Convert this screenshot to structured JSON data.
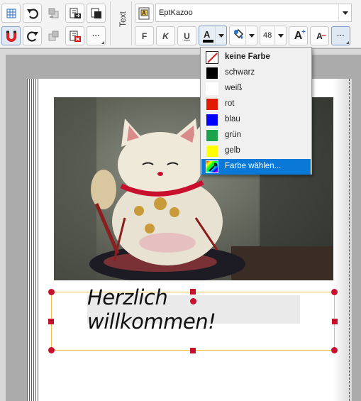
{
  "toolbar": {
    "section_label": "Text",
    "font_name": "EptKazoo",
    "bold_label": "F",
    "italic_label": "K",
    "underline_label": "U",
    "font_size": "48",
    "grow_label": "A",
    "shrink_label": "A",
    "more_label": "···"
  },
  "canvas": {
    "headline": "Herzlich willkommen!"
  },
  "color_menu": {
    "items": [
      {
        "label": "keine Farbe",
        "color": "none",
        "bold": true
      },
      {
        "label": "schwarz",
        "color": "#000000"
      },
      {
        "label": "weiß",
        "color": "#ffffff"
      },
      {
        "label": "rot",
        "color": "#e01b00"
      },
      {
        "label": "blau",
        "color": "#0000ff"
      },
      {
        "label": "grün",
        "color": "#1aa34a"
      },
      {
        "label": "gelb",
        "color": "#ffff00"
      },
      {
        "label": "Farbe wählen...",
        "color": "picker",
        "selected": true
      }
    ]
  },
  "colors": {
    "accent": "#0a78d7",
    "selection_handle": "#c8102e",
    "textbox_border": "#f0c040"
  }
}
